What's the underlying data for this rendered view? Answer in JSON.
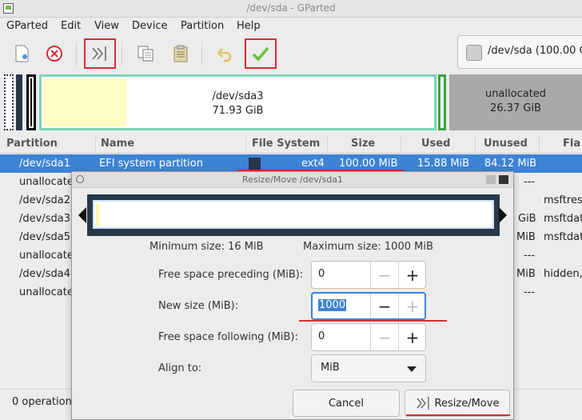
{
  "window": {
    "title": "/dev/sda - GParted"
  },
  "menubar": {
    "items": [
      "GParted",
      "Edit",
      "View",
      "Device",
      "Partition",
      "Help"
    ]
  },
  "toolbar": {
    "buttons": [
      "new-partition",
      "delete-partition",
      "resize-move",
      "copy",
      "paste",
      "undo",
      "apply"
    ],
    "highlight_color": "#d32f2f"
  },
  "device_selector": {
    "label": "/dev/sda (100.00 G"
  },
  "graph": {
    "sda3": {
      "name": "/dev/sda3",
      "size": "71.93 GiB",
      "color": "#7dd3b8"
    },
    "unallocated": {
      "name": "unallocated",
      "size": "26.37 GiB"
    }
  },
  "table": {
    "headers": [
      "Partition",
      "Name",
      "File System",
      "Size",
      "Used",
      "Unused",
      "Fla"
    ],
    "rows": [
      {
        "partition": "/dev/sda1",
        "name": "EFI system partition",
        "fs": "ext4",
        "size": "100.00 MiB",
        "used": "15.88 MiB",
        "unused": "84.12 MiB",
        "flags": "",
        "selected": true
      },
      {
        "partition": "unallocated",
        "right": "---",
        "flags": ""
      },
      {
        "partition": "/dev/sda2",
        "right": "",
        "flags": "msftres"
      },
      {
        "partition": "/dev/sda3",
        "right": "GiB",
        "flags": "msftdat"
      },
      {
        "partition": "/dev/sda5",
        "right": "MiB",
        "flags": "msftdat"
      },
      {
        "partition": "unallocated",
        "right": "---",
        "flags": ""
      },
      {
        "partition": "/dev/sda4",
        "right": "MiB",
        "flags": "hidden,"
      },
      {
        "partition": "unallocated",
        "right": "---",
        "flags": ""
      }
    ]
  },
  "statusbar": {
    "text": "0 operation"
  },
  "dialog": {
    "title": "Resize/Move /dev/sda1",
    "min_size": "Minimum size: 16 MiB",
    "max_size": "Maximum size: 1000 MiB",
    "fields": {
      "preceding": {
        "label": "Free space preceding (MiB):",
        "value": "0"
      },
      "new_size": {
        "label": "New size (MiB):",
        "value": "1000"
      },
      "following": {
        "label": "Free space following (MiB):",
        "value": "0"
      },
      "align": {
        "label": "Align to:",
        "value": "MiB"
      }
    },
    "cancel_label": "Cancel",
    "resize_label": "Resize/Move"
  }
}
